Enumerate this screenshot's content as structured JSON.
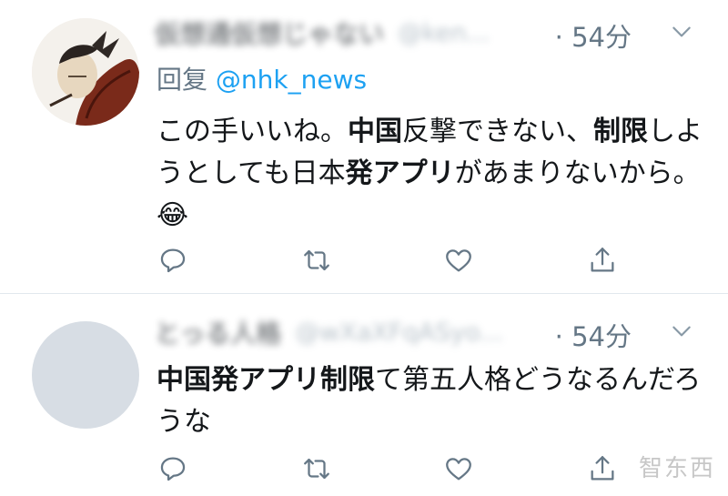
{
  "tweets": [
    {
      "user_name": "仮想通仮想じゃない",
      "handle": "@ken...",
      "time": "· 54分",
      "reply_prefix": "回复",
      "reply_to": "@nhk_news",
      "text_segments": [
        {
          "text": "この手いいね。",
          "bold": false
        },
        {
          "text": "中国",
          "bold": true
        },
        {
          "text": "反撃できない、",
          "bold": false
        },
        {
          "text": "制限",
          "bold": true
        },
        {
          "text": "しようとしても日本",
          "bold": false
        },
        {
          "text": "発アプリ",
          "bold": true
        },
        {
          "text": "があまりないから。",
          "bold": false
        },
        {
          "text": "😂",
          "bold": false
        }
      ]
    },
    {
      "user_name": "とっる人格",
      "handle": "@wXaXFqASyo...",
      "time": "· 54分",
      "text_segments": [
        {
          "text": "中国発アプリ制限",
          "bold": true
        },
        {
          "text": "て第五人格どうなるんだろうな",
          "bold": false
        }
      ]
    }
  ],
  "icons": {
    "reply": "reply-icon",
    "retweet": "retweet-icon",
    "like": "heart-icon",
    "share": "share-icon",
    "caret": "chevron-down-icon"
  },
  "watermark": "智东西",
  "colors": {
    "mention": "#1da1f2",
    "muted": "#657786",
    "divider": "#e1e8ed"
  }
}
